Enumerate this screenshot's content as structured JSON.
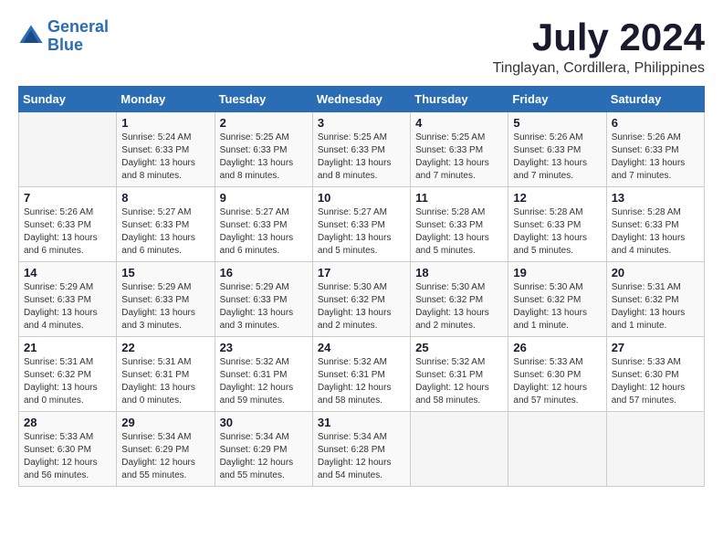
{
  "app": {
    "name": "GeneralBlue",
    "logo_text_part1": "General",
    "logo_text_part2": "Blue"
  },
  "calendar": {
    "title": "July 2024",
    "location": "Tinglayan, Cordillera, Philippines",
    "headers": [
      "Sunday",
      "Monday",
      "Tuesday",
      "Wednesday",
      "Thursday",
      "Friday",
      "Saturday"
    ],
    "weeks": [
      [
        {
          "day": "",
          "info": ""
        },
        {
          "day": "1",
          "info": "Sunrise: 5:24 AM\nSunset: 6:33 PM\nDaylight: 13 hours\nand 8 minutes."
        },
        {
          "day": "2",
          "info": "Sunrise: 5:25 AM\nSunset: 6:33 PM\nDaylight: 13 hours\nand 8 minutes."
        },
        {
          "day": "3",
          "info": "Sunrise: 5:25 AM\nSunset: 6:33 PM\nDaylight: 13 hours\nand 8 minutes."
        },
        {
          "day": "4",
          "info": "Sunrise: 5:25 AM\nSunset: 6:33 PM\nDaylight: 13 hours\nand 7 minutes."
        },
        {
          "day": "5",
          "info": "Sunrise: 5:26 AM\nSunset: 6:33 PM\nDaylight: 13 hours\nand 7 minutes."
        },
        {
          "day": "6",
          "info": "Sunrise: 5:26 AM\nSunset: 6:33 PM\nDaylight: 13 hours\nand 7 minutes."
        }
      ],
      [
        {
          "day": "7",
          "info": "Sunrise: 5:26 AM\nSunset: 6:33 PM\nDaylight: 13 hours\nand 6 minutes."
        },
        {
          "day": "8",
          "info": "Sunrise: 5:27 AM\nSunset: 6:33 PM\nDaylight: 13 hours\nand 6 minutes."
        },
        {
          "day": "9",
          "info": "Sunrise: 5:27 AM\nSunset: 6:33 PM\nDaylight: 13 hours\nand 6 minutes."
        },
        {
          "day": "10",
          "info": "Sunrise: 5:27 AM\nSunset: 6:33 PM\nDaylight: 13 hours\nand 5 minutes."
        },
        {
          "day": "11",
          "info": "Sunrise: 5:28 AM\nSunset: 6:33 PM\nDaylight: 13 hours\nand 5 minutes."
        },
        {
          "day": "12",
          "info": "Sunrise: 5:28 AM\nSunset: 6:33 PM\nDaylight: 13 hours\nand 5 minutes."
        },
        {
          "day": "13",
          "info": "Sunrise: 5:28 AM\nSunset: 6:33 PM\nDaylight: 13 hours\nand 4 minutes."
        }
      ],
      [
        {
          "day": "14",
          "info": "Sunrise: 5:29 AM\nSunset: 6:33 PM\nDaylight: 13 hours\nand 4 minutes."
        },
        {
          "day": "15",
          "info": "Sunrise: 5:29 AM\nSunset: 6:33 PM\nDaylight: 13 hours\nand 3 minutes."
        },
        {
          "day": "16",
          "info": "Sunrise: 5:29 AM\nSunset: 6:33 PM\nDaylight: 13 hours\nand 3 minutes."
        },
        {
          "day": "17",
          "info": "Sunrise: 5:30 AM\nSunset: 6:32 PM\nDaylight: 13 hours\nand 2 minutes."
        },
        {
          "day": "18",
          "info": "Sunrise: 5:30 AM\nSunset: 6:32 PM\nDaylight: 13 hours\nand 2 minutes."
        },
        {
          "day": "19",
          "info": "Sunrise: 5:30 AM\nSunset: 6:32 PM\nDaylight: 13 hours\nand 1 minute."
        },
        {
          "day": "20",
          "info": "Sunrise: 5:31 AM\nSunset: 6:32 PM\nDaylight: 13 hours\nand 1 minute."
        }
      ],
      [
        {
          "day": "21",
          "info": "Sunrise: 5:31 AM\nSunset: 6:32 PM\nDaylight: 13 hours\nand 0 minutes."
        },
        {
          "day": "22",
          "info": "Sunrise: 5:31 AM\nSunset: 6:31 PM\nDaylight: 13 hours\nand 0 minutes."
        },
        {
          "day": "23",
          "info": "Sunrise: 5:32 AM\nSunset: 6:31 PM\nDaylight: 12 hours\nand 59 minutes."
        },
        {
          "day": "24",
          "info": "Sunrise: 5:32 AM\nSunset: 6:31 PM\nDaylight: 12 hours\nand 58 minutes."
        },
        {
          "day": "25",
          "info": "Sunrise: 5:32 AM\nSunset: 6:31 PM\nDaylight: 12 hours\nand 58 minutes."
        },
        {
          "day": "26",
          "info": "Sunrise: 5:33 AM\nSunset: 6:30 PM\nDaylight: 12 hours\nand 57 minutes."
        },
        {
          "day": "27",
          "info": "Sunrise: 5:33 AM\nSunset: 6:30 PM\nDaylight: 12 hours\nand 57 minutes."
        }
      ],
      [
        {
          "day": "28",
          "info": "Sunrise: 5:33 AM\nSunset: 6:30 PM\nDaylight: 12 hours\nand 56 minutes."
        },
        {
          "day": "29",
          "info": "Sunrise: 5:34 AM\nSunset: 6:29 PM\nDaylight: 12 hours\nand 55 minutes."
        },
        {
          "day": "30",
          "info": "Sunrise: 5:34 AM\nSunset: 6:29 PM\nDaylight: 12 hours\nand 55 minutes."
        },
        {
          "day": "31",
          "info": "Sunrise: 5:34 AM\nSunset: 6:28 PM\nDaylight: 12 hours\nand 54 minutes."
        },
        {
          "day": "",
          "info": ""
        },
        {
          "day": "",
          "info": ""
        },
        {
          "day": "",
          "info": ""
        }
      ]
    ]
  }
}
